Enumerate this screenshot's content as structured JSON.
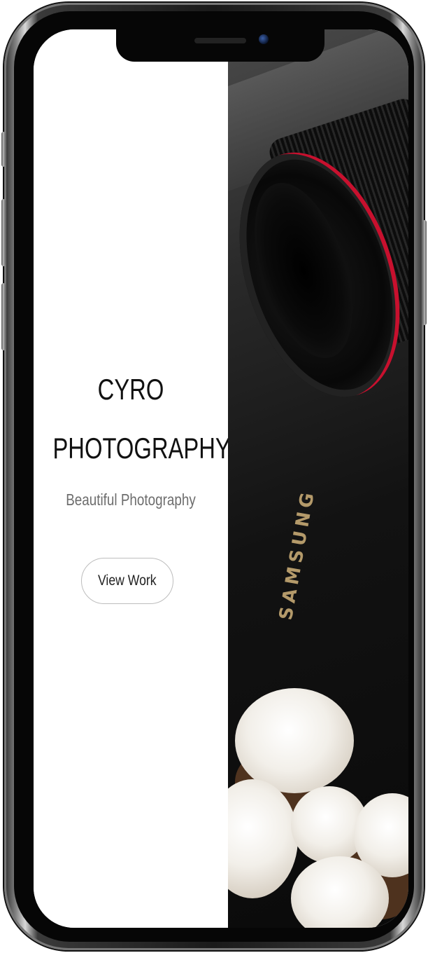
{
  "hero": {
    "title_line1": "CYRO",
    "title_line2": "PHOTOGRAPHY",
    "subtitle": "Beautiful Photography",
    "cta_label": "View Work"
  },
  "image_panel": {
    "brand_text": "SAMSUNG"
  },
  "colors": {
    "title": "#111111",
    "subtitle": "#6d6d6d",
    "button_border": "#bdbdbd",
    "lens_accent": "#c8102e",
    "brand_text": "#b49a6a"
  }
}
